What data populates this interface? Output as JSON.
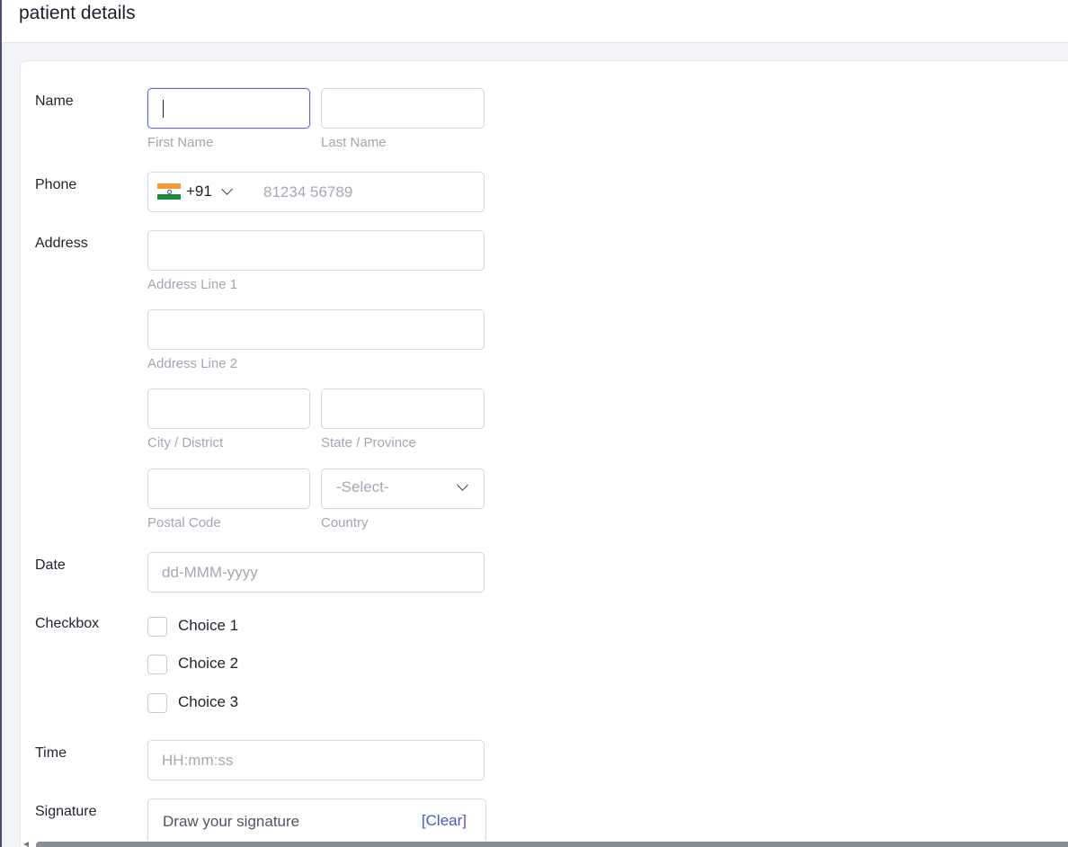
{
  "page": {
    "title": "patient details"
  },
  "form": {
    "name": {
      "label": "Name",
      "first_sub": "First Name",
      "last_sub": "Last Name"
    },
    "phone": {
      "label": "Phone",
      "dial_code": "+91",
      "placeholder": "81234 56789",
      "flag_icon": "india-flag-icon"
    },
    "address": {
      "label": "Address",
      "line1_sub": "Address Line 1",
      "line2_sub": "Address Line 2",
      "city_sub": "City / District",
      "state_sub": "State / Province",
      "postal_sub": "Postal Code",
      "country_sub": "Country",
      "country_selected": "-Select-"
    },
    "date": {
      "label": "Date",
      "placeholder": "dd-MMM-yyyy"
    },
    "checkbox": {
      "label": "Checkbox",
      "choices": [
        "Choice 1",
        "Choice 2",
        "Choice 3"
      ]
    },
    "time": {
      "label": "Time",
      "placeholder": "HH:mm:ss"
    },
    "signature": {
      "label": "Signature",
      "placeholder": "Draw your signature",
      "clear_label": "[Clear]"
    }
  },
  "colors": {
    "accent": "#4c56c8",
    "focus_border": "#6067c8",
    "placeholder": "#a4a8b4"
  }
}
